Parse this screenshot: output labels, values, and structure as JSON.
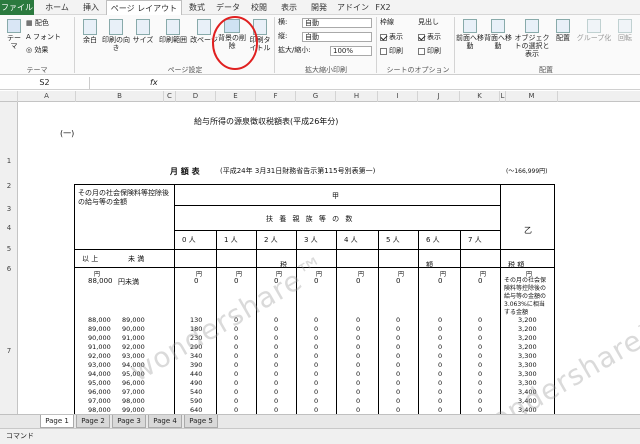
{
  "tabs": [
    "ファイル",
    "ホーム",
    "挿入",
    "ページ レイアウト",
    "数式",
    "データ",
    "校閲",
    "表示",
    "開発",
    "アドイン",
    "FX2"
  ],
  "ribbon": {
    "theme": "テーマ",
    "colors": "配色",
    "fonts": "フォント",
    "effects": "効果",
    "margins": "余白",
    "orientation": "印刷の向き",
    "size": "サイズ",
    "print_area": "印刷範囲",
    "breaks": "改ページ",
    "background_remove": "背景の削除",
    "print_titles": "印刷タイトル",
    "width_label": "横:",
    "width_value": "自動",
    "height_label": "縦:",
    "height_value": "自動",
    "scale_label": "拡大/縮小:",
    "scale_value": "100%",
    "gridlines": "枠線",
    "headings": "見出し",
    "view1": "表示",
    "print1": "印刷",
    "view2": "表示",
    "print2": "印刷",
    "bring_forward": "前面へ移動",
    "send_backward": "背面へ移動",
    "selection_pane": "オブジェクトの選択と表示",
    "align": "配置",
    "group": "グループ化",
    "rotate": "回転",
    "group_theme": "テーマ",
    "group_page_setup": "ページ設定",
    "group_scale": "拡大縮小印刷",
    "group_sheet_options": "シートのオプション",
    "group_arrange": "配置"
  },
  "formula_bar": {
    "name_box": "S2",
    "fx": "fx",
    "value": ""
  },
  "columns": [
    "A",
    "B",
    "C",
    "D",
    "E",
    "F",
    "G",
    "H",
    "I",
    "J",
    "K",
    "L",
    "M"
  ],
  "rows": [
    "1",
    "2",
    "3",
    "4",
    "5",
    "6",
    "7"
  ],
  "sheet": {
    "label_one": "(一)",
    "title": "給与所得の源泉徴収税額表(平成26年分)",
    "monthly": "月 額 表",
    "monthly_note": "(平成24年 3月31日財務省告示第115号別表第一)",
    "range_note": "(～166,999円)",
    "hdr_social": "その月の社会保険料等控除後の給与等の金額",
    "hdr_kou": "甲",
    "hdr_otsu": "乙",
    "hdr_dependents": "扶 養 親 族 等 の 数",
    "dep_cols": [
      "0 人",
      "1 人",
      "2 人",
      "3 人",
      "4 人",
      "5 人",
      "6 人",
      "7 人"
    ],
    "hdr_ijo": "以 上",
    "hdr_miman": "未 満",
    "hdr_zei": "税",
    "hdr_gaku": "額",
    "hdr_zeigaku": "税 額",
    "yen_row": [
      "円",
      "円",
      "円",
      "円",
      "円",
      "円",
      "円",
      "円",
      "円",
      "円",
      "円"
    ],
    "first_row": {
      "from": "88,000",
      "to": "円未満",
      "vals": [
        "0",
        "0",
        "0",
        "0",
        "0",
        "0",
        "0",
        "0"
      ]
    },
    "otsu_note": "その月の社会保険料等控除後の給与等の金額の3.063%に相当する金額",
    "data_rows": [
      {
        "from": "88,000",
        "to": "89,000",
        "kou": "130",
        "otsu": "3,200"
      },
      {
        "from": "89,000",
        "to": "90,000",
        "kou": "180",
        "otsu": "3,200"
      },
      {
        "from": "90,000",
        "to": "91,000",
        "kou": "230",
        "otsu": "3,200"
      },
      {
        "from": "91,000",
        "to": "92,000",
        "kou": "290",
        "otsu": "3,200"
      },
      {
        "from": "92,000",
        "to": "93,000",
        "kou": "340",
        "otsu": "3,300"
      },
      {
        "from": "93,000",
        "to": "94,000",
        "kou": "390",
        "otsu": "3,300"
      },
      {
        "from": "94,000",
        "to": "95,000",
        "kou": "440",
        "otsu": "3,300"
      },
      {
        "from": "95,000",
        "to": "96,000",
        "kou": "490",
        "otsu": "3,300"
      },
      {
        "from": "96,000",
        "to": "97,000",
        "kou": "540",
        "otsu": "3,400"
      },
      {
        "from": "97,000",
        "to": "98,000",
        "kou": "590",
        "otsu": "3,400"
      },
      {
        "from": "98,000",
        "to": "99,000",
        "kou": "640",
        "otsu": "3,400"
      }
    ],
    "zero": "0",
    "watermark": "wondershare™"
  },
  "sheet_tabs": [
    "Page 1",
    "Page 2",
    "Page 3",
    "Page 4",
    "Page 5"
  ],
  "status": {
    "mode": "コマンド"
  },
  "colors": {
    "file_tab": "#2b7a3e",
    "highlight_circle": "#e02020"
  }
}
